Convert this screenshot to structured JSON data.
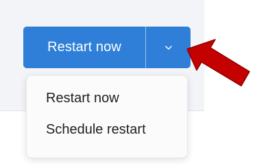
{
  "split_button": {
    "primary_label": "Restart now",
    "dropdown_icon": "chevron-down-icon"
  },
  "menu": {
    "items": [
      {
        "label": "Restart now"
      },
      {
        "label": "Schedule restart"
      }
    ]
  },
  "annotation": {
    "icon": "red-arrow-icon",
    "color": "#c40000"
  },
  "colors": {
    "accent": "#2f7fd8",
    "panel_background": "#f3f4f7",
    "menu_background": "#fbfbfc"
  }
}
